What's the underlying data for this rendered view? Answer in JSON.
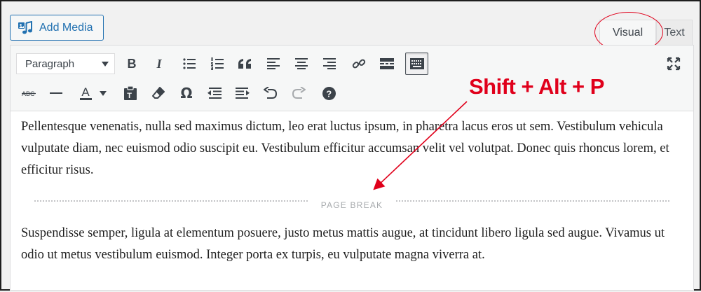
{
  "add_media": {
    "label": "Add Media",
    "icon": "add-media-icon"
  },
  "tabs": [
    {
      "label": "Visual",
      "active": true
    },
    {
      "label": "Text",
      "active": false
    }
  ],
  "toolbar": {
    "format_select": {
      "value": "Paragraph"
    },
    "row1": [
      "bold-icon",
      "italic-icon",
      "bulleted-list-icon",
      "numbered-list-icon",
      "blockquote-icon",
      "align-left-icon",
      "align-center-icon",
      "align-right-icon",
      "link-icon",
      "read-more-icon",
      "toolbar-toggle-icon"
    ],
    "row2": [
      "strikethrough-icon",
      "horizontal-line-icon",
      "text-color-icon",
      "paste-as-text-icon",
      "clear-formatting-icon",
      "special-character-icon",
      "outdent-icon",
      "indent-icon",
      "undo-icon",
      "redo-icon",
      "help-icon"
    ],
    "fullscreen": "fullscreen-icon",
    "bold_glyph": "B",
    "italic_glyph": "I",
    "text_color_glyph": "A",
    "special_char_glyph": "Ω"
  },
  "content": {
    "paragraph_1": "Pellentesque venenatis, nulla sed maximus dictum, leo erat luctus ipsum, in pharetra lacus eros ut sem. Vestibulum vehicula vulputate diam, nec euismod odio suscipit eu. Vestibulum efficitur accumsan velit vel volutpat. Donec quis rhoncus lorem, et efficitur risus.",
    "page_break_label": "PAGE BREAK",
    "paragraph_2": "Suspendisse semper, ligula at elementum posuere, justo metus mattis augue, at tincidunt libero ligula sed augue. Vivamus ut odio ut metus vestibulum euismod. Integer porta ex turpis, eu vulputate magna viverra at."
  },
  "annotation": {
    "text": "Shift + Alt + P",
    "color": "#e0001b"
  },
  "colors": {
    "accent": "#2271b1",
    "annotation_red": "#e0001b"
  }
}
